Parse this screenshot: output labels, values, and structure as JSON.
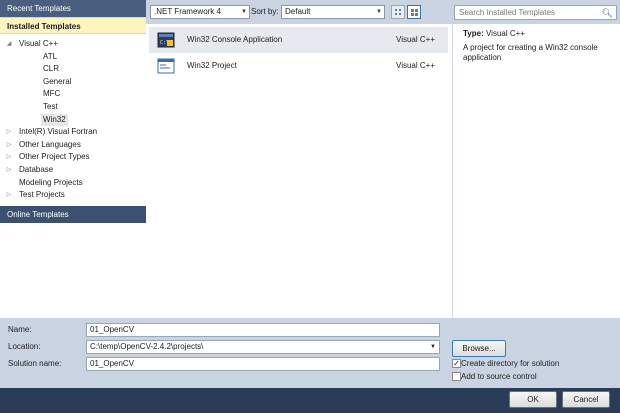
{
  "left_pane": {
    "recent_header": "Recent Templates",
    "installed_header": "Installed Templates",
    "online_header": "Online Templates",
    "tree": [
      {
        "label": "Visual C++",
        "level": 0,
        "expanded": true
      },
      {
        "label": "ATL",
        "level": 1
      },
      {
        "label": "CLR",
        "level": 1
      },
      {
        "label": "General",
        "level": 1
      },
      {
        "label": "MFC",
        "level": 1
      },
      {
        "label": "Test",
        "level": 1
      },
      {
        "label": "Win32",
        "level": 1,
        "selected": true
      },
      {
        "label": "Intel(R) Visual Fortran",
        "level": 0,
        "expanded": false
      },
      {
        "label": "Other Languages",
        "level": 0,
        "expanded": false
      },
      {
        "label": "Other Project Types",
        "level": 0,
        "expanded": false
      },
      {
        "label": "Database",
        "level": 0,
        "expanded": false
      },
      {
        "label": "Modeling Projects",
        "level": 0
      },
      {
        "label": "Test Projects",
        "level": 0,
        "expanded": false
      }
    ]
  },
  "toolbar": {
    "framework": ".NET Framework 4",
    "sortby_label": "Sort by:",
    "sortby_value": "Default",
    "search_placeholder": "Search Installed Templates"
  },
  "templates": [
    {
      "name": "Win32 Console Application",
      "language": "Visual C++",
      "selected": true,
      "icon": "console-app-icon"
    },
    {
      "name": "Win32 Project",
      "language": "Visual C++",
      "selected": false,
      "icon": "win32-project-icon"
    }
  ],
  "info": {
    "type_label": "Type:",
    "type_value": "Visual C++",
    "description": "A project for creating a Win32 console application"
  },
  "form": {
    "name_label": "Name:",
    "name_value": "01_OpenCV",
    "location_label": "Location:",
    "location_value": "C:\\temp\\OpenCV-2.4.2\\projects\\",
    "solution_label": "Solution name:",
    "solution_value": "01_OpenCV",
    "browse_label": "Browse...",
    "create_dir_label": "Create directory for solution",
    "create_dir_checked": true,
    "source_control_label": "Add to source control",
    "source_control_checked": false
  },
  "buttons": {
    "ok": "OK",
    "cancel": "Cancel"
  },
  "colors": {
    "frame": "#2b3c59",
    "header_dark": "#3c5070",
    "installed_highlight": "#fdf4bf",
    "toolbar_bg": "#c9d3e2"
  }
}
